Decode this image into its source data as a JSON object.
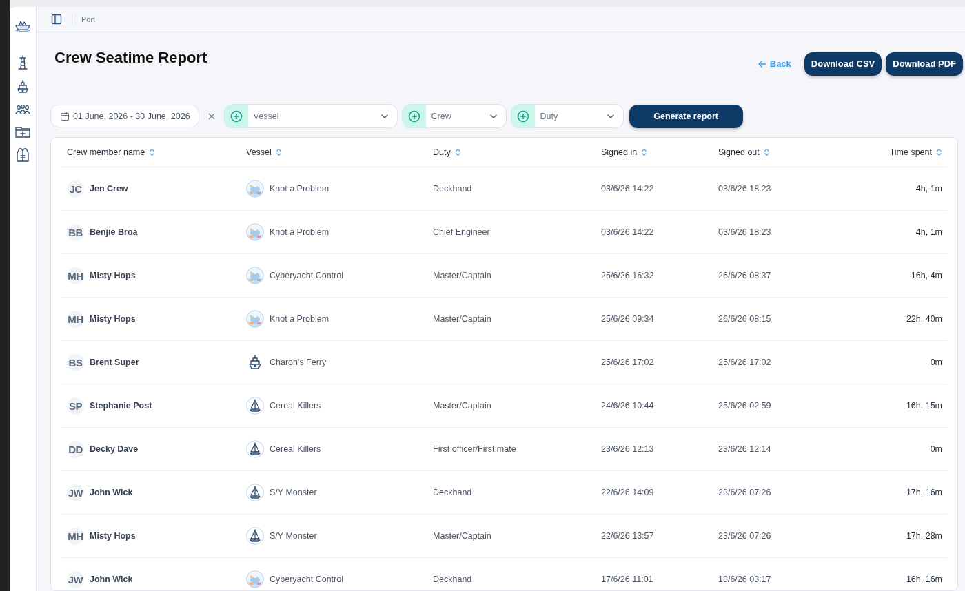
{
  "breadcrumb": {
    "label": "Port"
  },
  "page": {
    "title": "Crew Seatime Report",
    "back": "Back",
    "buttons": [
      "Download CSV",
      "Download PDF"
    ]
  },
  "filters": {
    "date_range": "01 June, 2026 - 30 June, 2026",
    "selects": [
      {
        "placeholder": "Vessel"
      },
      {
        "placeholder": "Crew"
      },
      {
        "placeholder": "Duty"
      }
    ],
    "button": "Generate report"
  },
  "table": {
    "columns": [
      {
        "label": "Crew member name"
      },
      {
        "label": "Vessel"
      },
      {
        "label": "Duty"
      },
      {
        "label": "Signed in"
      },
      {
        "label": "Signed out"
      },
      {
        "label": "Time spent"
      }
    ],
    "rows": [
      {
        "initials": "JC",
        "name": "Jen Crew",
        "vessel": {
          "name": "Knot a Problem",
          "kind": "picture"
        },
        "duty": "Deckhand",
        "signed_in": "03/6/26 14:22",
        "signed_out": "03/6/26 18:23",
        "time_spent": "4h, 1m"
      },
      {
        "initials": "BB",
        "name": "Benjie Broa",
        "vessel": {
          "name": "Knot a Problem",
          "kind": "picture"
        },
        "duty": "Chief Engineer",
        "signed_in": "03/6/26 14:22",
        "signed_out": "03/6/26 18:23",
        "time_spent": "4h, 1m"
      },
      {
        "initials": "MH",
        "name": "Misty Hops",
        "vessel": {
          "name": "Cyberyacht Control",
          "kind": "picture"
        },
        "duty": "Master/Captain",
        "signed_in": "25/6/26 16:32",
        "signed_out": "26/6/26 08:37",
        "time_spent": "16h, 4m"
      },
      {
        "initials": "MH",
        "name": "Misty Hops",
        "vessel": {
          "name": "Knot a Problem",
          "kind": "picture"
        },
        "duty": "Master/Captain",
        "signed_in": "25/6/26 09:34",
        "signed_out": "26/6/26 08:15",
        "time_spent": "22h, 40m"
      },
      {
        "initials": "BS",
        "name": "Brent Super",
        "vessel": {
          "name": "Charon's Ferry",
          "kind": "ship"
        },
        "signed_in": "25/6/26 17:02",
        "signed_out": "25/6/26 17:02",
        "time_spent": "0m"
      },
      {
        "initials": "SP",
        "name": "Stephanie Post",
        "vessel": {
          "name": "Cereal Killers",
          "kind": "sailboat"
        },
        "duty": "Master/Captain",
        "signed_in": "24/6/26 10:44",
        "signed_out": "25/6/26 02:59",
        "time_spent": "16h, 15m"
      },
      {
        "initials": "DD",
        "name": "Decky Dave",
        "vessel": {
          "name": "Cereal Killers",
          "kind": "sailboat"
        },
        "duty": "First officer/First mate",
        "signed_in": "23/6/26 12:13",
        "signed_out": "23/6/26 12:14",
        "time_spent": "0m"
      },
      {
        "initials": "JW",
        "name": "John Wick",
        "vessel": {
          "name": "S/Y Monster",
          "kind": "sailboat"
        },
        "duty": "Deckhand",
        "signed_in": "22/6/26 14:09",
        "signed_out": "23/6/26 07:26",
        "time_spent": "17h, 16m"
      },
      {
        "initials": "MH",
        "name": "Misty Hops",
        "vessel": {
          "name": "S/Y Monster",
          "kind": "sailboat"
        },
        "duty": "Master/Captain",
        "signed_in": "22/6/26 13:57",
        "signed_out": "23/6/26 07:26",
        "time_spent": "17h, 28m"
      },
      {
        "initials": "JW",
        "name": "John Wick",
        "vessel": {
          "name": "Cyberyacht Control",
          "kind": "picture"
        },
        "duty": "Deckhand",
        "signed_in": "17/6/26 11:01",
        "signed_out": "18/6/26 03:17",
        "time_spent": "16h, 16m"
      }
    ]
  }
}
